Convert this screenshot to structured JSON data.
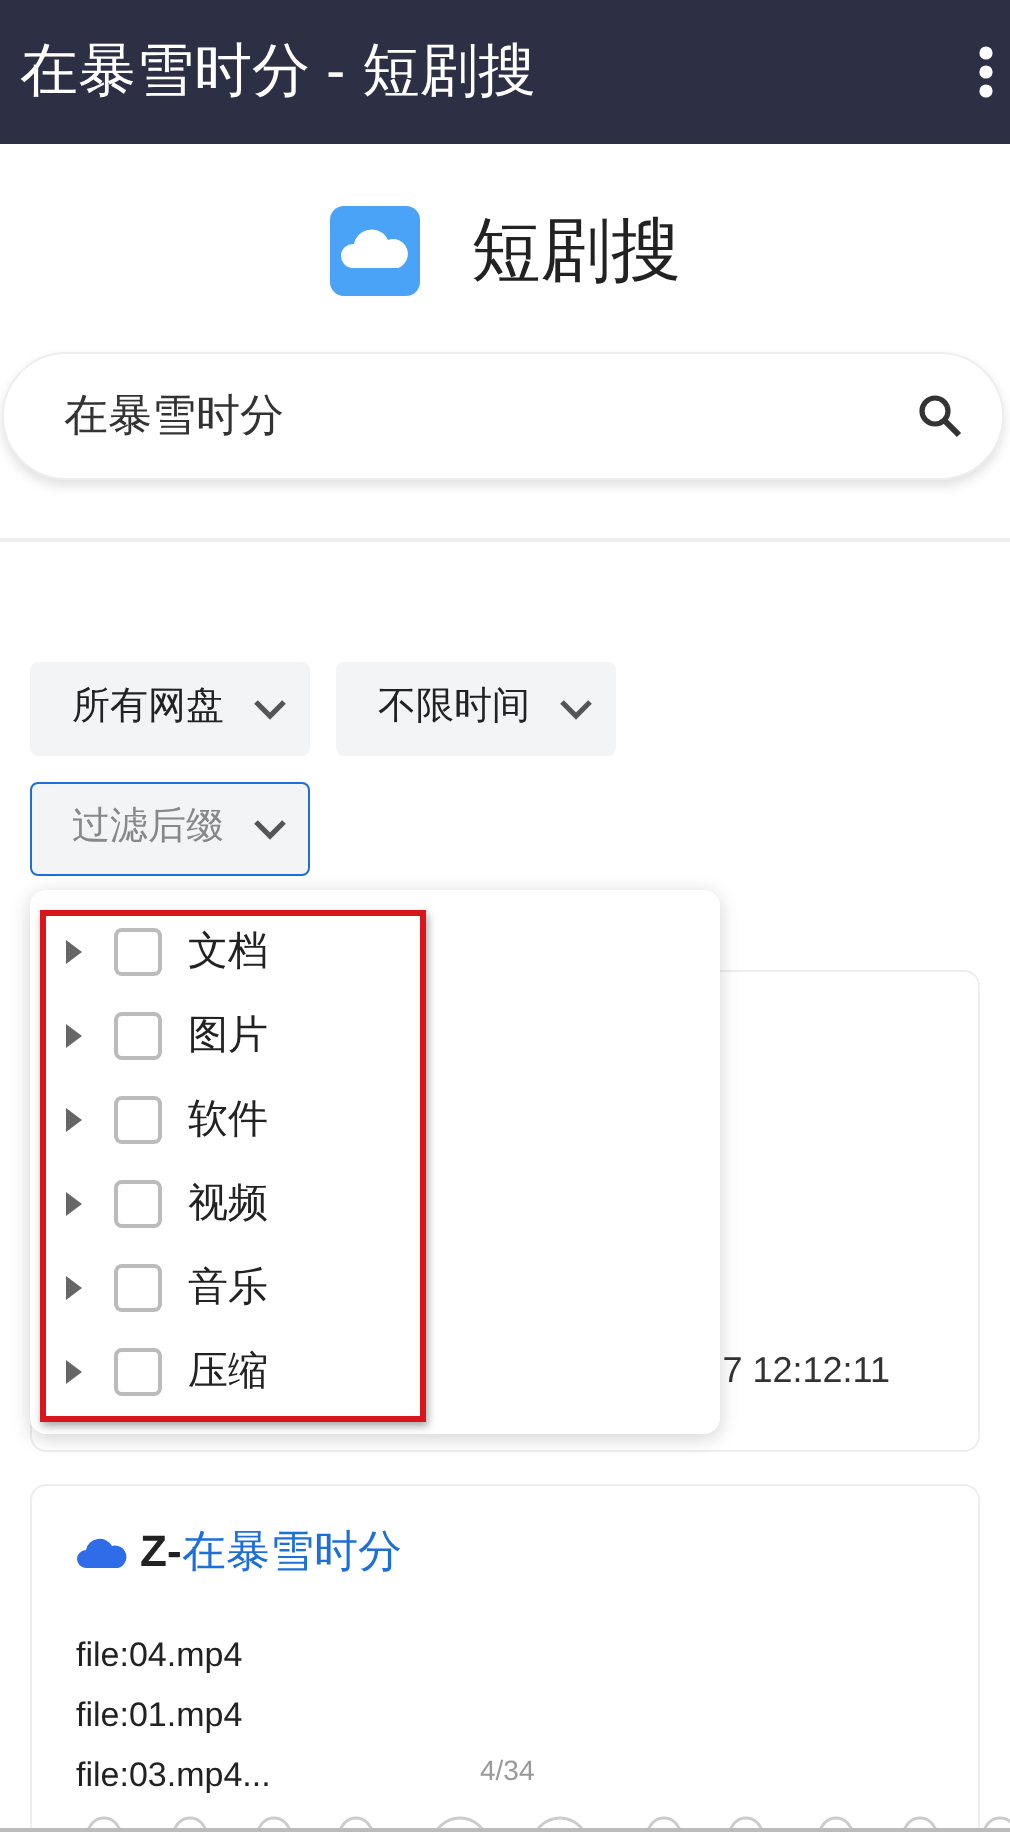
{
  "app_bar": {
    "title": "在暴雪时分 - 短剧搜"
  },
  "brand": {
    "name": "短剧搜"
  },
  "search": {
    "value": "在暴雪时分"
  },
  "filters": [
    {
      "label": "所有网盘",
      "open": false
    },
    {
      "label": "不限时间",
      "open": false
    },
    {
      "placeholder": "过滤后缀",
      "open": true
    }
  ],
  "dropdown": {
    "items": [
      {
        "label": "文档",
        "checked": false,
        "expanded": false
      },
      {
        "label": "图片",
        "checked": false,
        "expanded": false
      },
      {
        "label": "软件",
        "checked": false,
        "expanded": false
      },
      {
        "label": "视频",
        "checked": false,
        "expanded": false
      },
      {
        "label": "音乐",
        "checked": false,
        "expanded": false
      },
      {
        "label": "压缩",
        "checked": false,
        "expanded": false
      }
    ]
  },
  "results": [
    {
      "date": "7 12:12:11"
    },
    {
      "title_prefix": "Z-",
      "title": "在暴雪时分",
      "files": [
        "file:04.mp4",
        "file:01.mp4",
        "file:03.mp4..."
      ]
    }
  ],
  "page_counter": "4/34"
}
